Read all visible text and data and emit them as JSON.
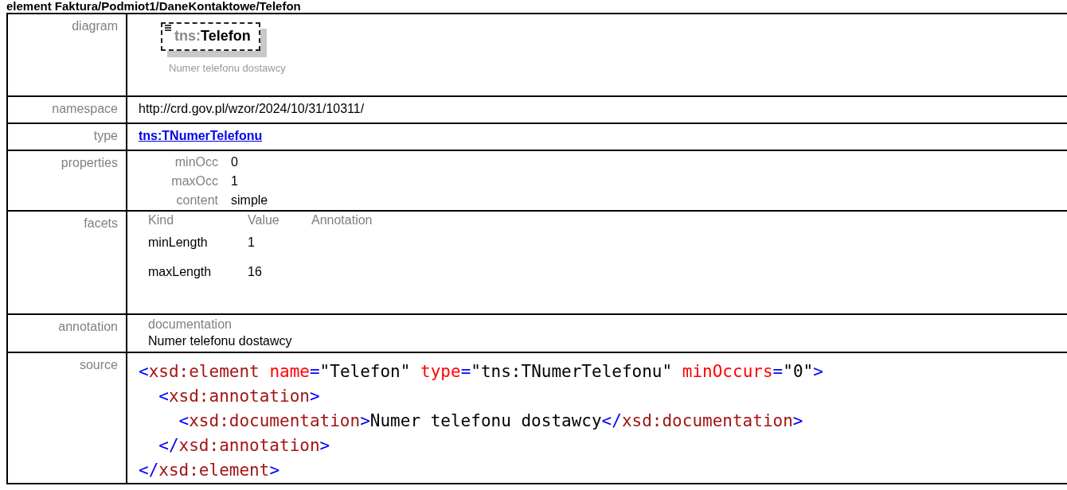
{
  "heading": "element Faktura/Podmiot1/DaneKontaktowe/Telefon",
  "diagram": {
    "label": "diagram",
    "prefix": "tns:",
    "name": "Telefon",
    "caption": "Numer telefonu dostawcy"
  },
  "namespace": {
    "label": "namespace",
    "value": "http://crd.gov.pl/wzor/2024/10/31/10311/"
  },
  "type": {
    "label": "type",
    "link": "tns:TNumerTelefonu"
  },
  "properties": {
    "label": "properties",
    "items": [
      {
        "key": "minOcc",
        "value": "0"
      },
      {
        "key": "maxOcc",
        "value": "1"
      },
      {
        "key": "content",
        "value": "simple"
      }
    ]
  },
  "facets": {
    "label": "facets",
    "columns": [
      "Kind",
      "Value",
      "Annotation"
    ],
    "rows": [
      {
        "kind": "minLength",
        "value": "1"
      },
      {
        "kind": "maxLength",
        "value": "16"
      }
    ]
  },
  "annotation": {
    "label": "annotation",
    "title": "documentation",
    "text": "Numer telefonu dostawcy"
  },
  "source": {
    "label": "source",
    "lines": [
      {
        "tokens": [
          {
            "kind": "punct",
            "text": "<"
          },
          {
            "kind": "tag",
            "text": "xsd:element"
          },
          {
            "kind": "attr",
            "text": " name"
          },
          {
            "kind": "punct",
            "text": "="
          },
          {
            "kind": "value",
            "text": "\"Telefon\""
          },
          {
            "kind": "attr",
            "text": " type"
          },
          {
            "kind": "punct",
            "text": "="
          },
          {
            "kind": "value",
            "text": "\"tns:TNumerTelefonu\""
          },
          {
            "kind": "attr",
            "text": " minOccurs"
          },
          {
            "kind": "punct",
            "text": "="
          },
          {
            "kind": "value",
            "text": "\"0\""
          },
          {
            "kind": "punct",
            "text": ">"
          }
        ],
        "children": [
          {
            "tokens": [
              {
                "kind": "punct",
                "text": "<"
              },
              {
                "kind": "tag",
                "text": "xsd:annotation"
              },
              {
                "kind": "punct",
                "text": ">"
              }
            ],
            "children": [
              {
                "tokens": [
                  {
                    "kind": "punct",
                    "text": "<"
                  },
                  {
                    "kind": "tag",
                    "text": "xsd:documentation"
                  },
                  {
                    "kind": "punct",
                    "text": ">"
                  },
                  {
                    "kind": "text",
                    "text": "Numer telefonu dostawcy"
                  },
                  {
                    "kind": "punct",
                    "text": "</"
                  },
                  {
                    "kind": "tag",
                    "text": "xsd:documentation"
                  },
                  {
                    "kind": "punct",
                    "text": ">"
                  }
                ]
              }
            ]
          },
          {
            "tokens": [
              {
                "kind": "punct",
                "text": "</"
              },
              {
                "kind": "tag",
                "text": "xsd:annotation"
              },
              {
                "kind": "punct",
                "text": ">"
              }
            ]
          }
        ]
      },
      {
        "tokens": [
          {
            "kind": "punct",
            "text": "</"
          },
          {
            "kind": "tag",
            "text": "xsd:element"
          },
          {
            "kind": "punct",
            "text": ">"
          }
        ]
      }
    ]
  }
}
